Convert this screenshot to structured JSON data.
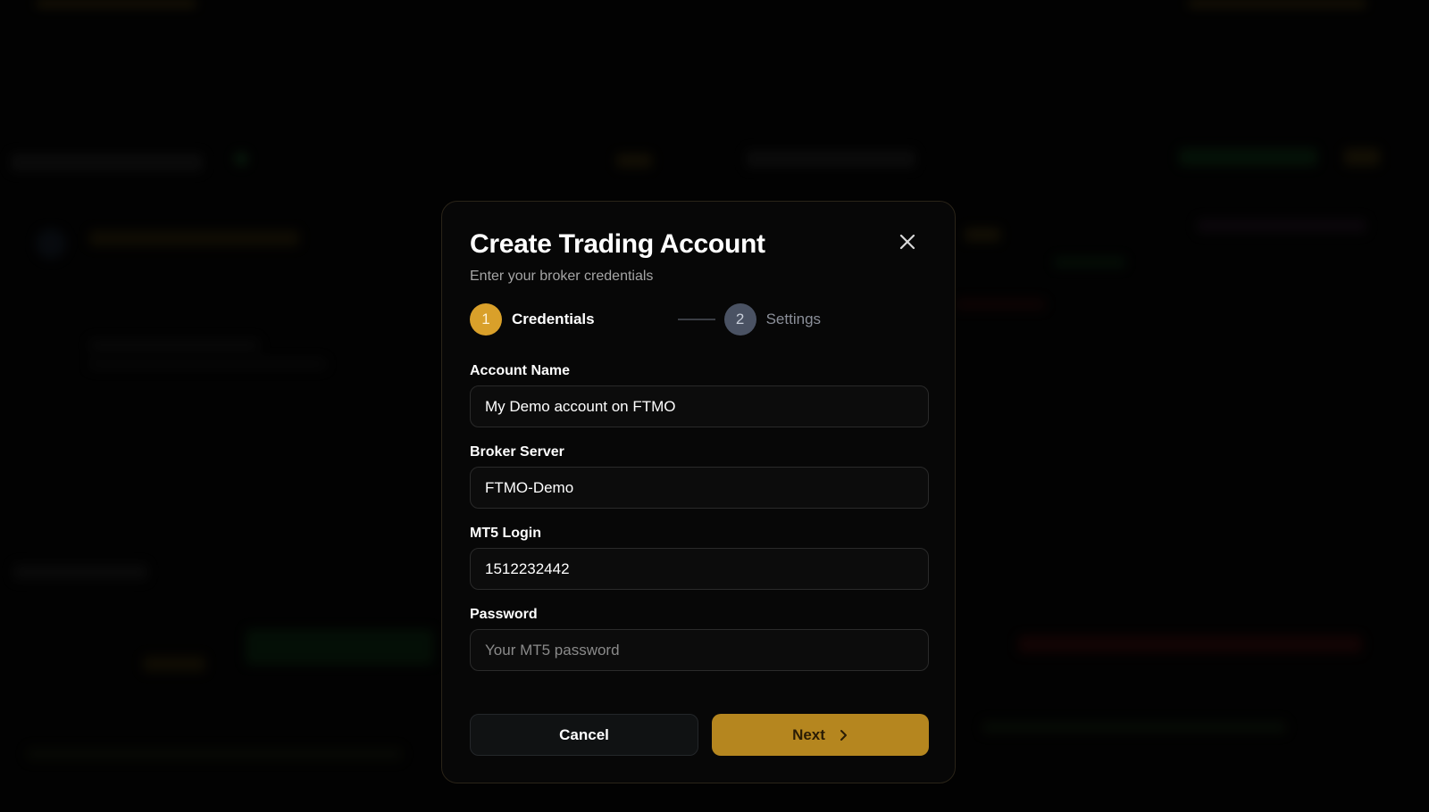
{
  "modal": {
    "title": "Create Trading Account",
    "subtitle": "Enter your broker credentials",
    "close_icon": "close-icon"
  },
  "stepper": {
    "steps": [
      {
        "number": "1",
        "label": "Credentials",
        "state": "active"
      },
      {
        "number": "2",
        "label": "Settings",
        "state": "inactive"
      }
    ]
  },
  "form": {
    "account_name": {
      "label": "Account Name",
      "value": "My Demo account on FTMO"
    },
    "broker_server": {
      "label": "Broker Server",
      "value": "FTMO-Demo"
    },
    "mt5_login": {
      "label": "MT5 Login",
      "value": "1512232442"
    },
    "password": {
      "label": "Password",
      "value": "",
      "placeholder": "Your MT5 password"
    }
  },
  "actions": {
    "cancel_label": "Cancel",
    "next_label": "Next",
    "next_icon": "chevron-right-icon"
  },
  "colors": {
    "accent": "#d9a02a",
    "next_button": "#b5861f",
    "step_inactive": "#4a5263",
    "background": "#050505"
  }
}
